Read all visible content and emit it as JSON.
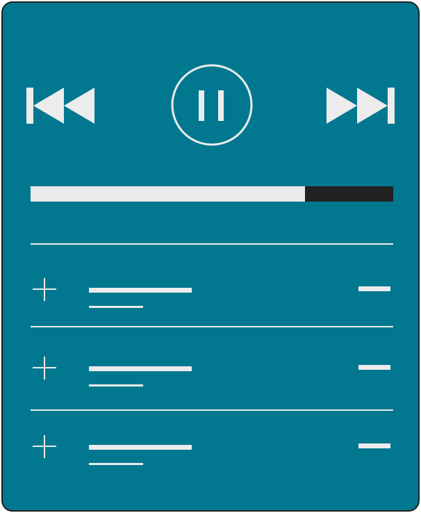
{
  "player": {
    "state": "playing",
    "progress": 0.756,
    "controls": [
      "previous-track",
      "pause",
      "next-track"
    ],
    "icons": {
      "previous": "rewind-icon",
      "pause": "pause-icon",
      "next": "fast-forward-icon",
      "add": "plus-icon",
      "remove": "minus-icon"
    }
  },
  "playlist": {
    "items": [
      {
        "id": 1
      },
      {
        "id": 2
      },
      {
        "id": 3
      }
    ]
  },
  "colors": {
    "background": "#027890",
    "foreground": "#ececec",
    "progress_remaining": "#222222",
    "border": "#1f1f1f"
  }
}
